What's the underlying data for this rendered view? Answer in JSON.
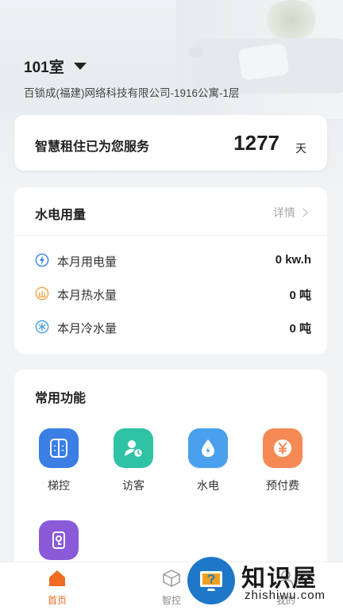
{
  "header": {
    "room": "101室",
    "address": "百锁成(福建)网络科技有限公司-1916公寓-1层"
  },
  "service": {
    "label": "智慧租住已为您服务",
    "days": "1277",
    "unit": "天"
  },
  "utility": {
    "title": "水电用量",
    "detail_label": "详情",
    "rows": [
      {
        "label": "本月用电量",
        "value": "0 kw.h",
        "icon": "lightning-icon",
        "color": "#3b86e8"
      },
      {
        "label": "本月热水量",
        "value": "0 吨",
        "icon": "hot-water-icon",
        "color": "#f0a64b"
      },
      {
        "label": "本月冷水量",
        "value": "0 吨",
        "icon": "snowflake-icon",
        "color": "#4aa3e0"
      }
    ]
  },
  "functions": {
    "title": "常用功能",
    "items": [
      {
        "label": "梯控",
        "icon": "elevator-icon",
        "color": "#3a7ee6"
      },
      {
        "label": "访客",
        "icon": "visitor-icon",
        "color": "#2fc2a4"
      },
      {
        "label": "水电",
        "icon": "water-drop-icon",
        "color": "#4aa0ee"
      },
      {
        "label": "预付费",
        "icon": "yuan-icon",
        "color": "#f58a55"
      },
      {
        "label": "",
        "icon": "door-lock-icon",
        "color": "#8a5ad9"
      }
    ]
  },
  "tabbar": {
    "items": [
      {
        "label": "首页",
        "icon": "home-icon",
        "active": true
      },
      {
        "label": "智控",
        "icon": "cube-icon",
        "active": false
      },
      {
        "label": "我的",
        "icon": "user-icon",
        "active": false
      }
    ]
  },
  "watermark": {
    "text": "知识屋",
    "url": "zhishiwu.com"
  },
  "colors": {
    "accent": "#f26b22",
    "background": "#f2f3f5"
  }
}
